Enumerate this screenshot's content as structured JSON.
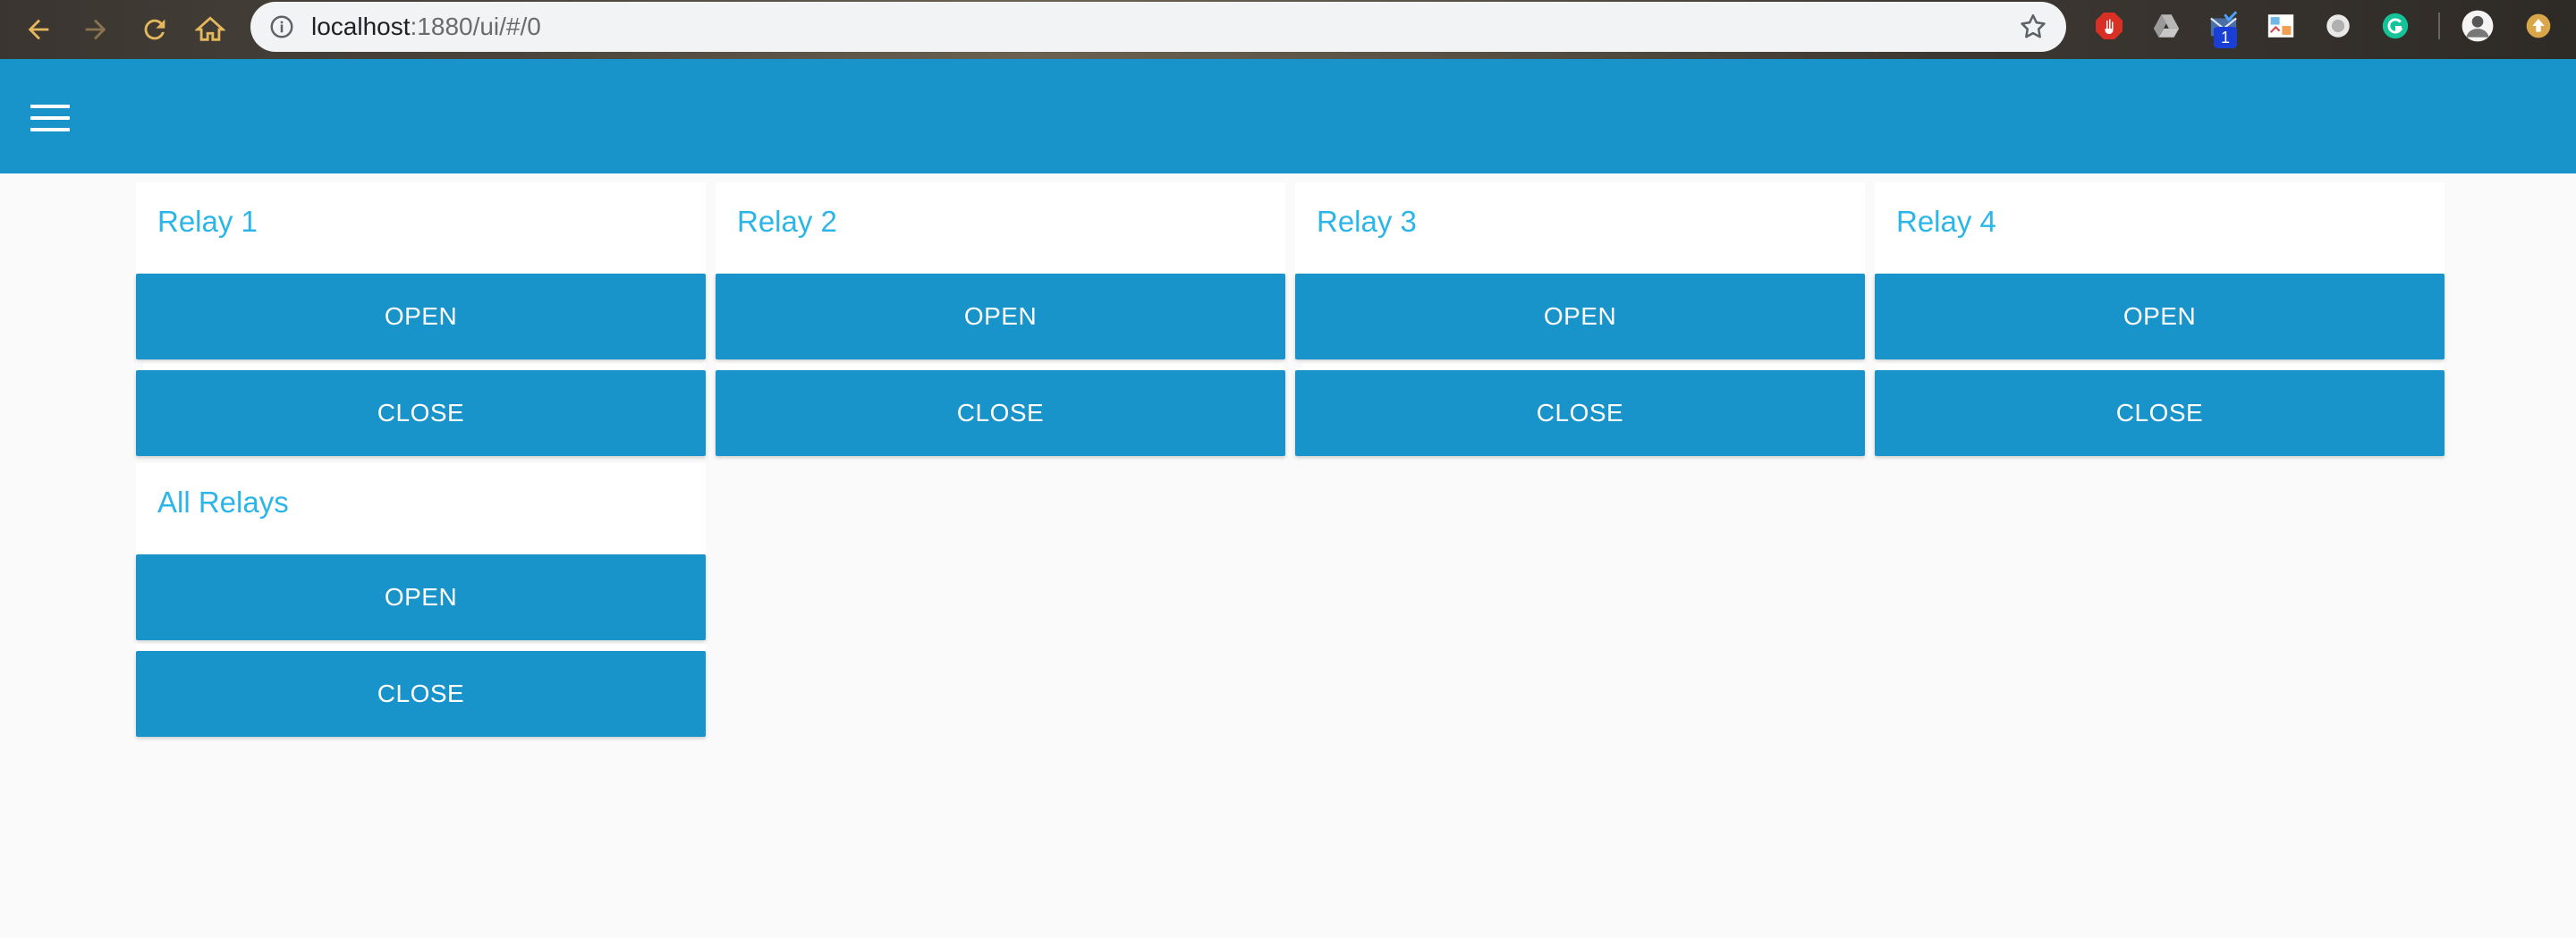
{
  "browser": {
    "url_host": "localhost",
    "url_rest": ":1880/ui/#/0",
    "icons": [
      "back-icon",
      "forward-icon",
      "reload-icon",
      "home-icon",
      "info-icon",
      "star-icon"
    ],
    "extensions": [
      "adblock-icon",
      "drive-icon",
      "mail-checker-icon",
      "image-extension-icon",
      "circle-extension-icon",
      "grammarly-icon",
      "profile-avatar-icon",
      "update-icon"
    ],
    "mail_badge": "1"
  },
  "header": {
    "menu_icon": "hamburger-menu-icon",
    "color": "#1994cb"
  },
  "groups": [
    {
      "title": "Relay 1",
      "open_label": "OPEN",
      "close_label": "CLOSE"
    },
    {
      "title": "Relay 2",
      "open_label": "OPEN",
      "close_label": "CLOSE"
    },
    {
      "title": "Relay 3",
      "open_label": "OPEN",
      "close_label": "CLOSE"
    },
    {
      "title": "Relay 4",
      "open_label": "OPEN",
      "close_label": "CLOSE"
    },
    {
      "title": "All Relays",
      "open_label": "OPEN",
      "close_label": "CLOSE"
    }
  ],
  "colors": {
    "accent": "#1994cb",
    "title_text": "#2bb5e8",
    "background": "#fafafa"
  }
}
